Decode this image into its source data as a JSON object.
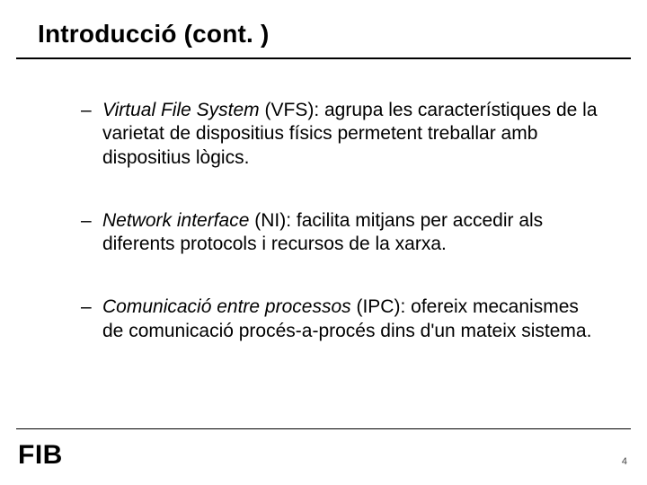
{
  "title": "Introducció (cont. )",
  "bullets": [
    {
      "term": "Virtual File System",
      "abbr_and_text": " (VFS): agrupa les característiques de la varietat de dispositius físics permetent treballar amb dispositius lògics."
    },
    {
      "term": "Network interface",
      "abbr_and_text": " (NI): facilita mitjans  per accedir als diferents protocols i recursos de la xarxa."
    },
    {
      "term": "Comunicació entre processos",
      "abbr_and_text": " (IPC): ofereix mecanismes de comunicació procés-a-procés dins d'un mateix sistema."
    }
  ],
  "logo": "FIB",
  "page_number": "4",
  "dash": "–"
}
